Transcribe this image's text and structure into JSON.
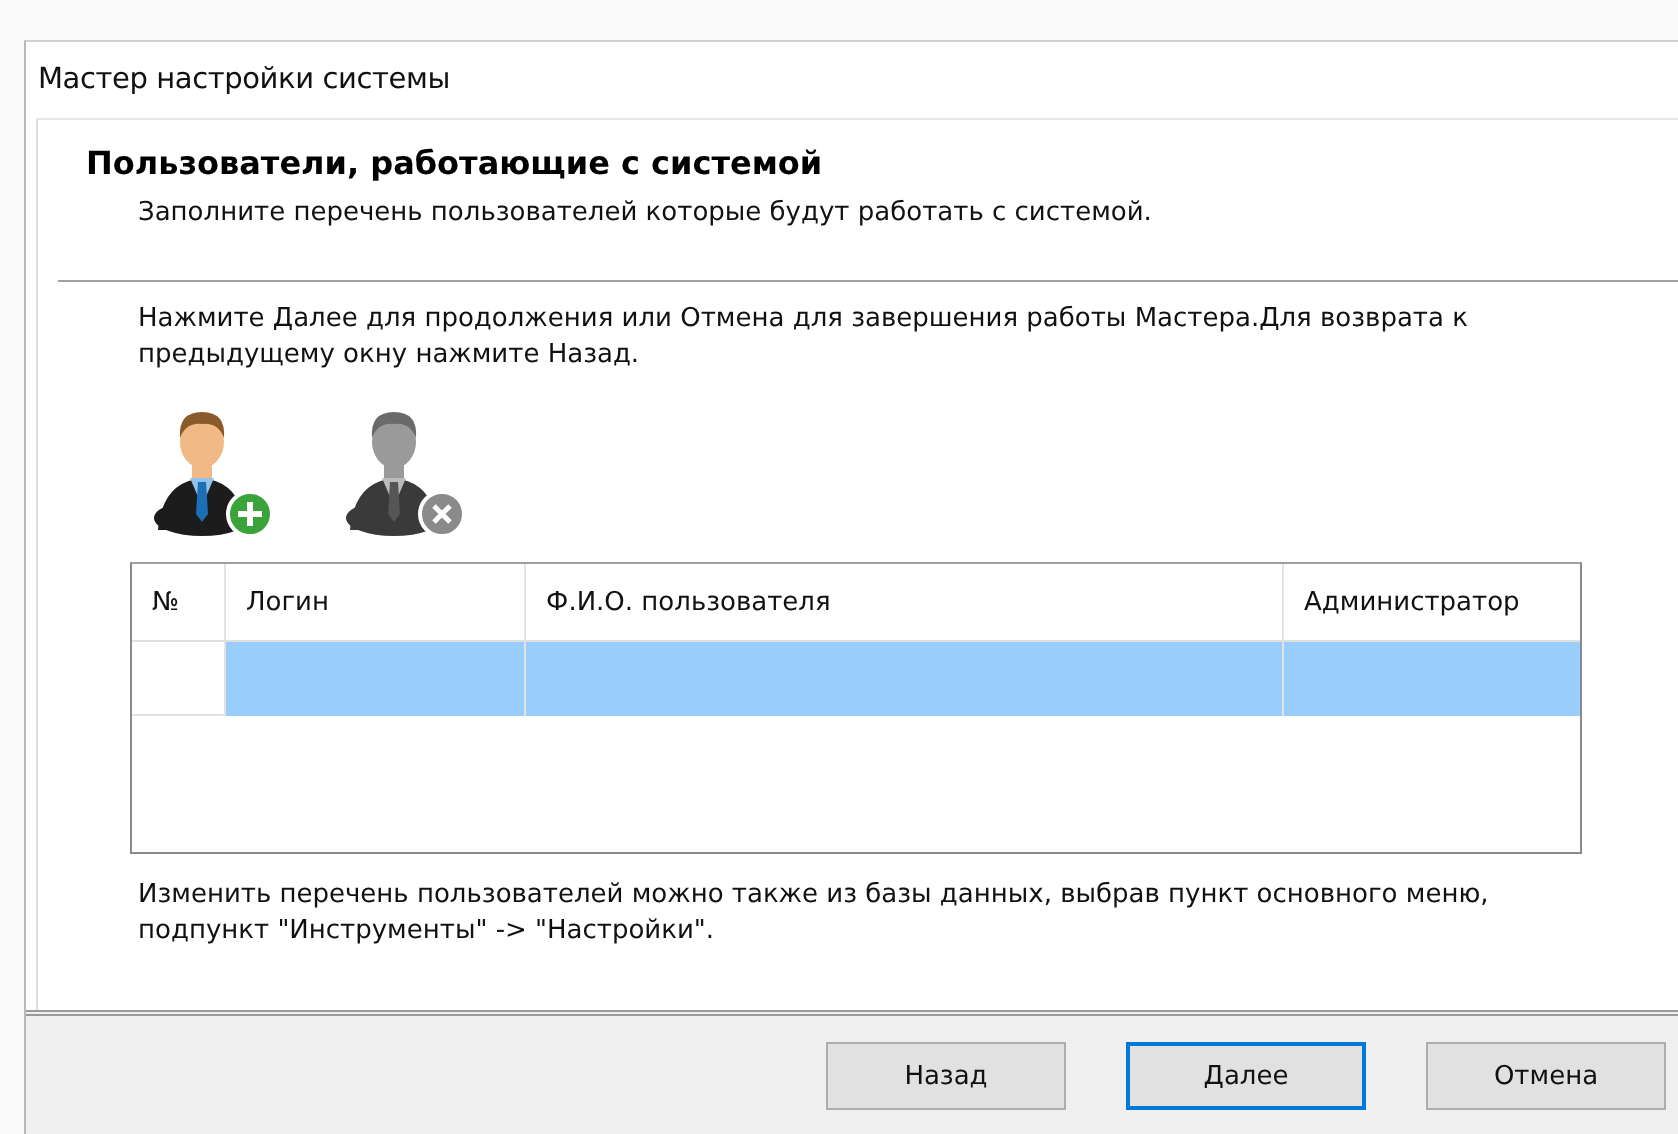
{
  "window": {
    "title": "Мастер настройки системы"
  },
  "header": {
    "title": "Пользователи, работающие с системой",
    "subtitle": "Заполните перечень пользователей которые будут работать с системой."
  },
  "instructions": "Нажмите Далее для продолжения или Отмена для завершения работы Мастера.Для возврата к предыдущему окну нажмите Назад.",
  "toolbar": [
    {
      "kind": "add",
      "disabled": false
    },
    {
      "kind": "remove",
      "disabled": true
    }
  ],
  "table": {
    "columns": [
      "№",
      "Логин",
      "Ф.И.О. пользователя",
      "Администратор"
    ],
    "rows": [
      {
        "selected": true
      }
    ]
  },
  "note": "Изменить перечень пользователей можно также из базы данных, выбрав пункт основного меню, подпункт \"Инструменты\" -> \"Настройки\".",
  "buttons": [
    {
      "label": "Назад",
      "default": false
    },
    {
      "label": "Далее",
      "default": true
    },
    {
      "label": "Отмена",
      "default": false
    }
  ]
}
